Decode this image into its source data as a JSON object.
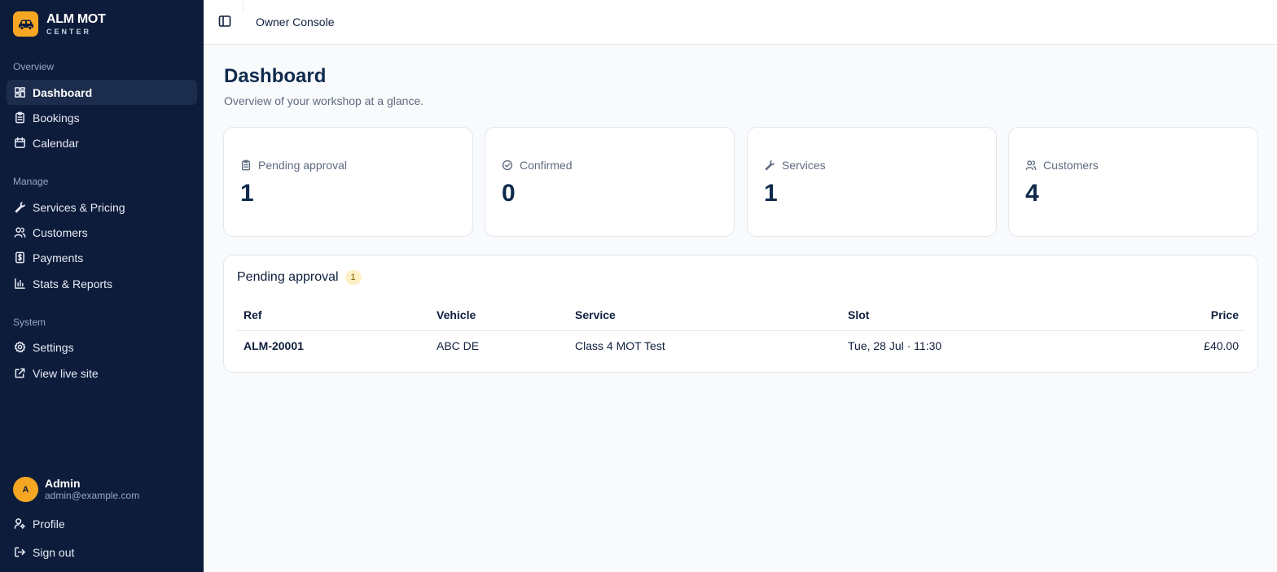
{
  "brand": {
    "name": "ALM MOT",
    "sub": "CENTER",
    "accent": "#f5a623"
  },
  "sidebar": {
    "sections": [
      "Overview",
      "Manage",
      "System"
    ],
    "items": [
      {
        "label": "Dashboard",
        "icon": "dashboard-icon",
        "active": true
      },
      {
        "label": "Bookings",
        "icon": "clipboard-icon"
      },
      {
        "label": "Calendar",
        "icon": "calendar-icon"
      },
      {
        "label": "Services & Pricing",
        "icon": "wrench-icon"
      },
      {
        "label": "Customers",
        "icon": "users-icon"
      },
      {
        "label": "Payments",
        "icon": "receipt-icon"
      },
      {
        "label": "Stats & Reports",
        "icon": "bar-chart-icon"
      },
      {
        "label": "Settings",
        "icon": "gear-icon"
      },
      {
        "label": "View live site",
        "icon": "external-link-icon"
      }
    ],
    "user": {
      "initial": "A",
      "name": "Admin",
      "email": "admin@example.com"
    },
    "footer": [
      {
        "label": "Profile",
        "icon": "user-key-icon"
      },
      {
        "label": "Sign out",
        "icon": "sign-out-icon"
      }
    ]
  },
  "topbar": {
    "title": "Owner Console"
  },
  "page": {
    "title": "Dashboard",
    "subtitle": "Overview of your workshop at a glance."
  },
  "stats": [
    {
      "label": "Pending approval",
      "value": "1",
      "icon": "clipboard-icon"
    },
    {
      "label": "Confirmed",
      "value": "0",
      "icon": "check-circle-icon"
    },
    {
      "label": "Services",
      "value": "1",
      "icon": "wrench-icon"
    },
    {
      "label": "Customers",
      "value": "4",
      "icon": "users-icon"
    }
  ],
  "pending": {
    "title": "Pending approval",
    "count": "1",
    "columns": [
      "Ref",
      "Vehicle",
      "Service",
      "Slot",
      "Price"
    ],
    "rows": [
      [
        "ALM-20001",
        "ABC DE",
        "Class 4 MOT Test",
        "Tue, 28 Jul · 11:30",
        "£40.00"
      ]
    ]
  }
}
